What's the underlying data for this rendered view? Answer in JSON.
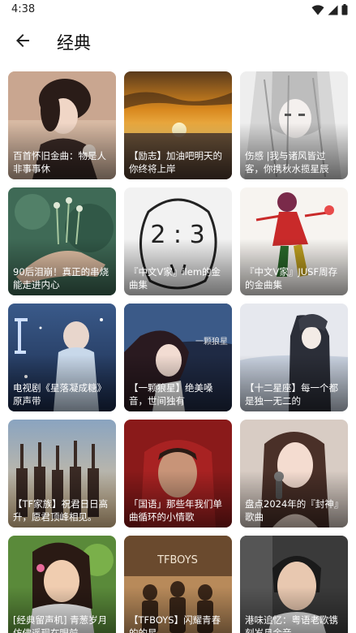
{
  "status_bar": {
    "time": "4:38"
  },
  "app_bar": {
    "title": "经典"
  },
  "colors": {
    "background": "#ffffff",
    "caption_text": "#ffffff"
  },
  "playlists": [
    {
      "title": "百首怀旧金曲：物是人非事事休",
      "icon": "portrait-vintage-image"
    },
    {
      "title": "【励志】加油吧明天的你终将上岸",
      "icon": "sunset-sea-image"
    },
    {
      "title": "伤感 |我与诸风皆过客，你携秋水揽星辰",
      "icon": "anime-silver-hair-image"
    },
    {
      "title": "90后泪崩！真正的串烧能走进内心",
      "icon": "hand-with-flowers-image"
    },
    {
      "title": "『中文V家』ilem的金曲集",
      "icon": "doodle-face-image"
    },
    {
      "title": "『中文V家』JUSF周存的金曲集",
      "icon": "anime-red-dress-image"
    },
    {
      "title": "电视剧《星落凝成糖》原声带",
      "icon": "drama-poster-image"
    },
    {
      "title": "【一颗狼星】绝美嗓音，世间独有",
      "icon": "anime-girl-wind-image"
    },
    {
      "title": "【十二星座】每一个都是独一无二的",
      "icon": "anime-boy-sky-image"
    },
    {
      "title": "【TF家族】祝君日日高升，愿君顶峰相见。",
      "icon": "group-cheering-image"
    },
    {
      "title": "「国语」那些年我们单曲循环的小情歌",
      "icon": "singer-red-hoodie-image"
    },
    {
      "title": "盘点2024年的『封神』歌曲",
      "icon": "woman-microphone-image"
    },
    {
      "title": "[经典留声机] 青葱岁月仿佛遥现在眼前",
      "icon": "woman-smiling-image"
    },
    {
      "title": "【TFBOYS】闪耀青春的的星",
      "icon": "tfboys-stage-image"
    },
    {
      "title": "港味追忆：粤语老歌镌刻岁月金音",
      "icon": "man-portrait-image"
    }
  ]
}
